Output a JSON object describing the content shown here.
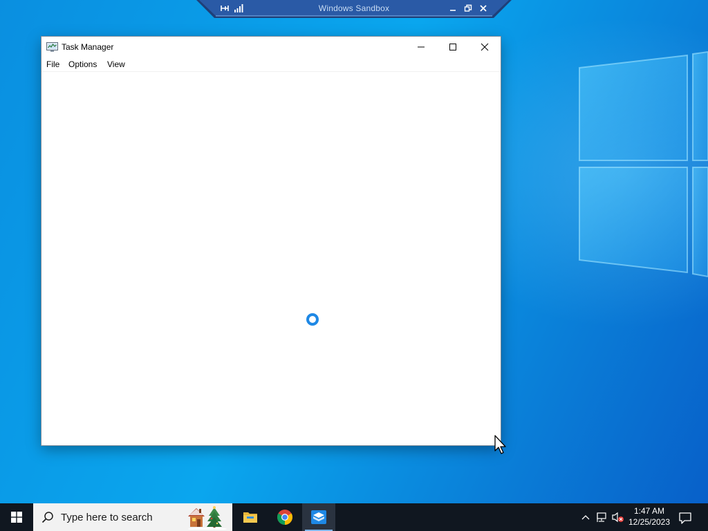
{
  "sandbox": {
    "title": "Windows Sandbox",
    "icons": [
      "pin-icon",
      "signal-icon",
      "minimize-icon",
      "restore-icon",
      "close-icon"
    ]
  },
  "window": {
    "title": "Task Manager",
    "menu": [
      "File",
      "Options",
      "View"
    ],
    "controls": [
      "minimize-icon",
      "maximize-icon",
      "close-icon"
    ],
    "status": "loading"
  },
  "taskbar": {
    "search_placeholder": "Type here to search",
    "apps": [
      "file-explorer-icon",
      "chrome-icon",
      "windows-sandbox-icon"
    ],
    "active_app": "windows-sandbox-icon",
    "tray_icons": [
      "chevron-up-icon",
      "network-icon",
      "volume-muted-icon"
    ],
    "clock": {
      "time": "1:47 AM",
      "date": "12/25/2023"
    }
  },
  "colors": {
    "desktop": "#0a9be6",
    "taskbar": "#101720",
    "sandbox_bar": "#1f3f78",
    "spinner": "#1e88e5"
  }
}
